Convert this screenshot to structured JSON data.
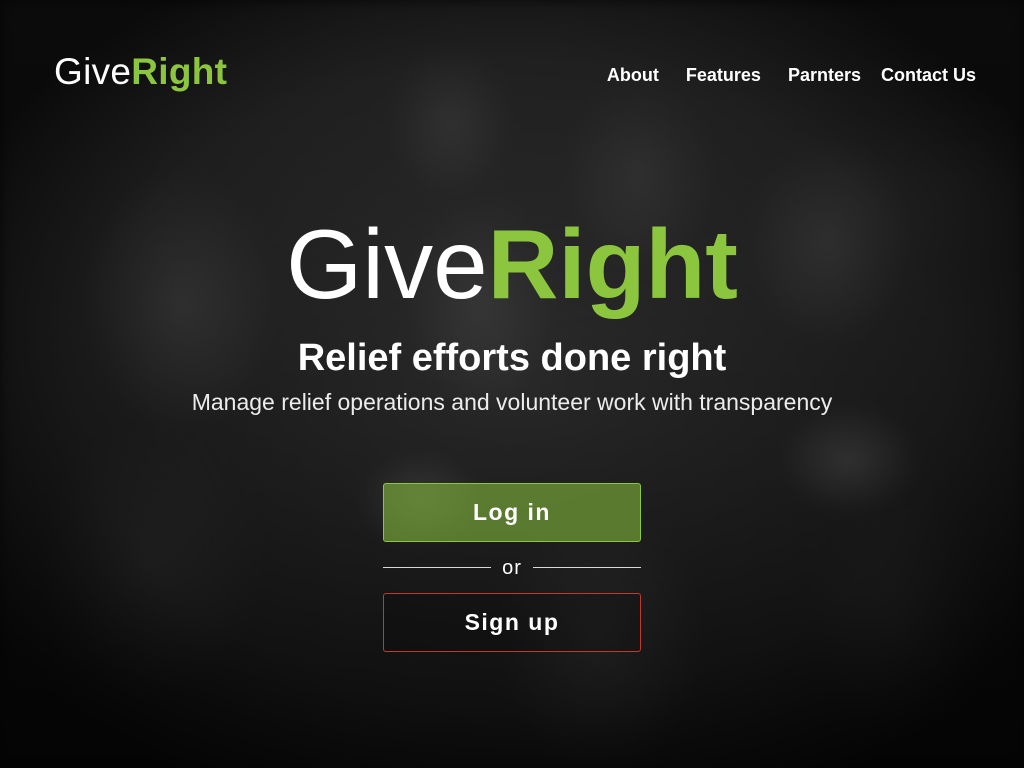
{
  "brand": {
    "name_light": "Give",
    "name_bold": "Right"
  },
  "nav": {
    "items": [
      {
        "label": "About"
      },
      {
        "label": "Features"
      },
      {
        "label": "Parnters"
      },
      {
        "label": "Contact Us"
      }
    ]
  },
  "hero": {
    "logo_light": "Give",
    "logo_bold": "Right",
    "tagline": "Relief efforts done right",
    "subline": "Manage relief operations and volunteer work with transparency"
  },
  "actions": {
    "login_label": "Log in",
    "divider_label": "or",
    "signup_label": "Sign up"
  },
  "colors": {
    "accent": "#8cc63f",
    "signup_border": "#c0392b",
    "text": "#ffffff"
  }
}
